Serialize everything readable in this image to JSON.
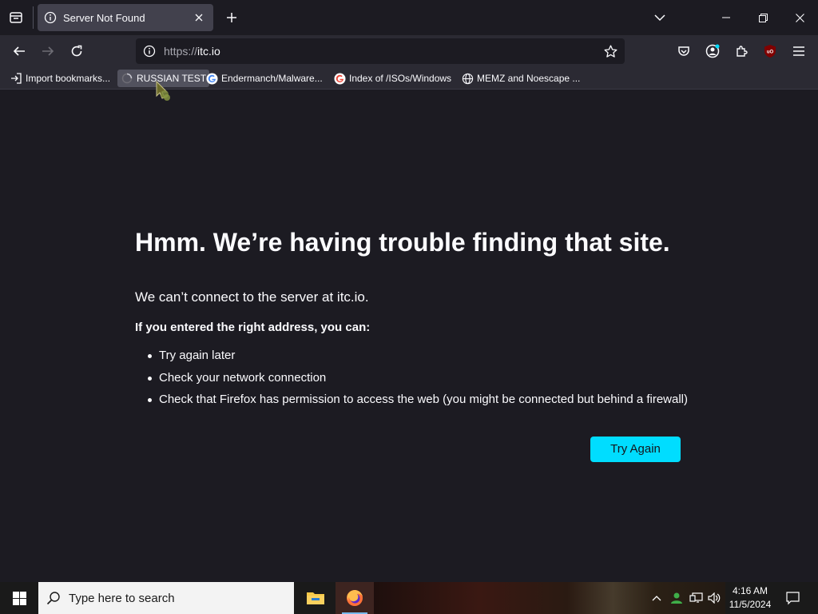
{
  "browser": {
    "tab": {
      "title": "Server Not Found"
    },
    "url": {
      "protocol": "https://",
      "host": "itc.io"
    },
    "bookmarks": [
      {
        "label": "Import bookmarks...",
        "icon": "import-icon"
      },
      {
        "label": "RUSSIAN TEST",
        "icon": "loading-icon"
      },
      {
        "label": "Endermanch/Malware...",
        "icon": "google-icon"
      },
      {
        "label": "Index of /ISOs/Windows",
        "icon": "google-icon"
      },
      {
        "label": "MEMZ and Noescape ...",
        "icon": "globe-icon"
      }
    ]
  },
  "error": {
    "title": "Hmm. We’re having trouble finding that site.",
    "description": "We can’t connect to the server at itc.io.",
    "subtitle": "If you entered the right address, you can:",
    "suggestions": [
      "Try again later",
      "Check your network connection",
      "Check that Firefox has permission to access the web (you might be connected but behind a firewall)"
    ],
    "button": "Try Again"
  },
  "taskbar": {
    "search_placeholder": "Type here to search",
    "time": "4:16 AM",
    "date": "11/5/2024"
  },
  "colors": {
    "accent": "#00ddff",
    "page_bg": "#1c1b22",
    "toolbar_bg": "#2b2a33"
  }
}
